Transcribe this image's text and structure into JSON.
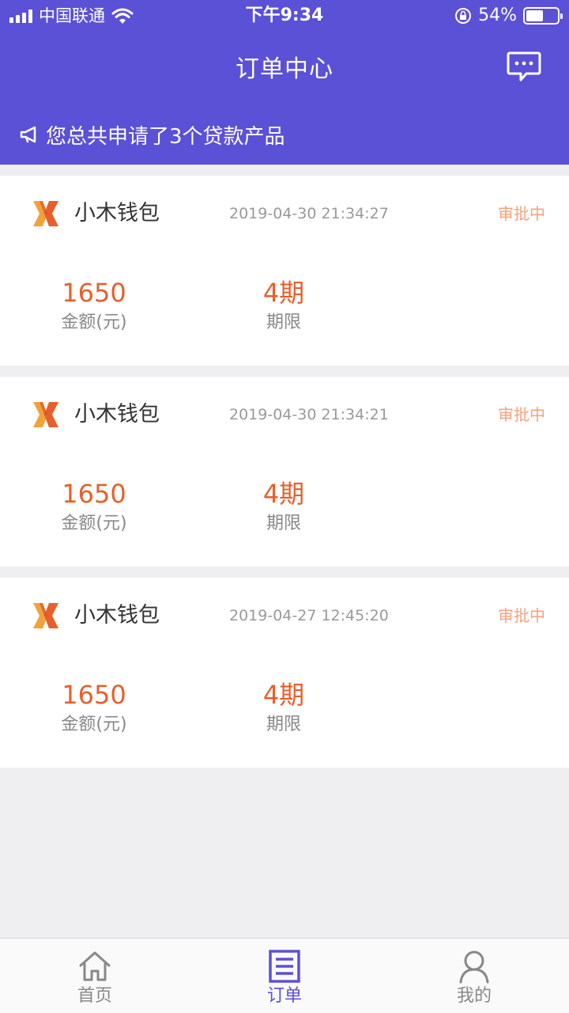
{
  "status_bar": {
    "carrier": "中国联通",
    "time": "下午9:34",
    "battery": "54%",
    "battery_level": 0.54
  },
  "header": {
    "title": "订单中心",
    "message_icon": "chat-bubble-icon"
  },
  "notice": {
    "text": "您总共申请了3个贷款产品",
    "icon": "megaphone-icon"
  },
  "orders": [
    {
      "name": "小木钱包",
      "time": "2019-04-30 21:34:27",
      "status": "审批中",
      "amount": "1650",
      "amount_label": "金额(元)",
      "term": "4期",
      "term_label": "期限"
    },
    {
      "name": "小木钱包",
      "time": "2019-04-30 21:34:21",
      "status": "审批中",
      "amount": "1650",
      "amount_label": "金额(元)",
      "term": "4期",
      "term_label": "期限"
    },
    {
      "name": "小木钱包",
      "time": "2019-04-27 12:45:20",
      "status": "审批中",
      "amount": "1650",
      "amount_label": "金额(元)",
      "term": "4期",
      "term_label": "期限"
    }
  ],
  "tabbar": {
    "items": [
      {
        "label": "首页",
        "icon": "home-icon",
        "active": false
      },
      {
        "label": "订单",
        "icon": "order-list-icon",
        "active": true
      },
      {
        "label": "我的",
        "icon": "user-icon",
        "active": false
      }
    ]
  },
  "colors": {
    "brand": "#5b51d6",
    "amount": "#e5602c",
    "status": "#f6a27d"
  }
}
